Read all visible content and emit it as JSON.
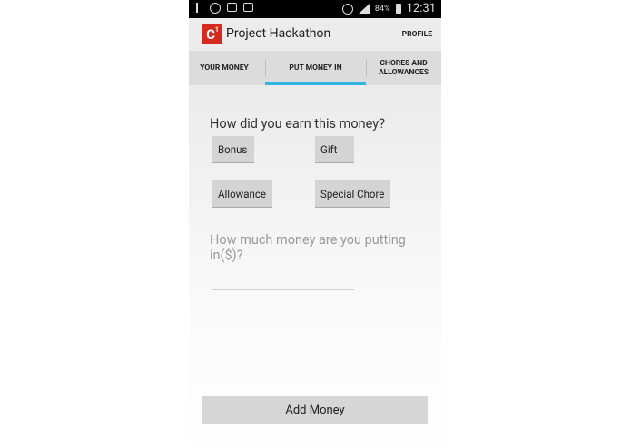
{
  "status_bar": {
    "battery": "84%",
    "time": "12:31"
  },
  "header": {
    "app_title": "Project Hackathon",
    "logo_text": "C",
    "logo_sup": "1",
    "profile_label": "PROFILE"
  },
  "tabs": [
    {
      "label": "YOUR MONEY"
    },
    {
      "label": "PUT MONEY IN"
    },
    {
      "label": "CHORES AND ALLOWANCES"
    }
  ],
  "form": {
    "earn_question": "How did you earn this money?",
    "options": [
      "Bonus",
      "Gift",
      "Allowance",
      "Special Chore"
    ],
    "amount_question": "How much money are you putting in($)?",
    "amount_value": ""
  },
  "submit_label": "Add Money",
  "colors": {
    "tab_indicator": "#33b5e5",
    "logo_red": "#d52b1e"
  }
}
